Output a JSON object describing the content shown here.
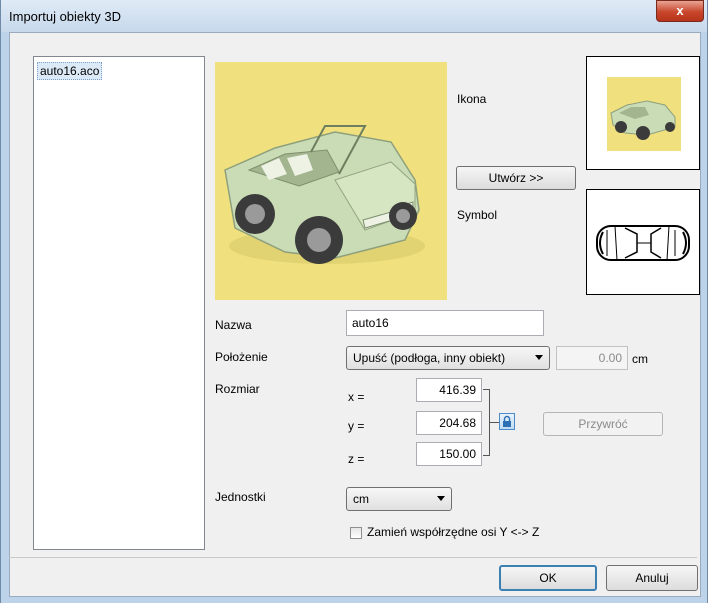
{
  "window": {
    "title": "Importuj obiekty 3D",
    "close_glyph": "x"
  },
  "file_list": {
    "items": [
      "auto16.aco"
    ]
  },
  "preview": {
    "icon_label": "Ikona",
    "symbol_label": "Symbol",
    "create_button": "Utwórz >>"
  },
  "form": {
    "name_label": "Nazwa",
    "name_value": "auto16",
    "position_label": "Położenie",
    "position_value": "Upuść (podłoga, inny obiekt)",
    "offset_value": "0.00",
    "offset_unit": "cm",
    "size_label": "Rozmiar",
    "x_label": "x =",
    "x_value": "416.39",
    "y_label": "y =",
    "y_value": "204.68",
    "z_label": "z =",
    "z_value": "150.00",
    "restore_button": "Przywróć",
    "units_label": "Jednostki",
    "units_value": "cm",
    "swap_axes_label": "Zamień współrzędne osi Y <-> Z",
    "swap_axes_checked": false
  },
  "footer": {
    "ok_button": "OK",
    "cancel_button": "Anuluj"
  },
  "colors": {
    "preview_bg": "#f0e17e",
    "close_button": "#c9462c",
    "car_body": "#c9dcb6"
  }
}
